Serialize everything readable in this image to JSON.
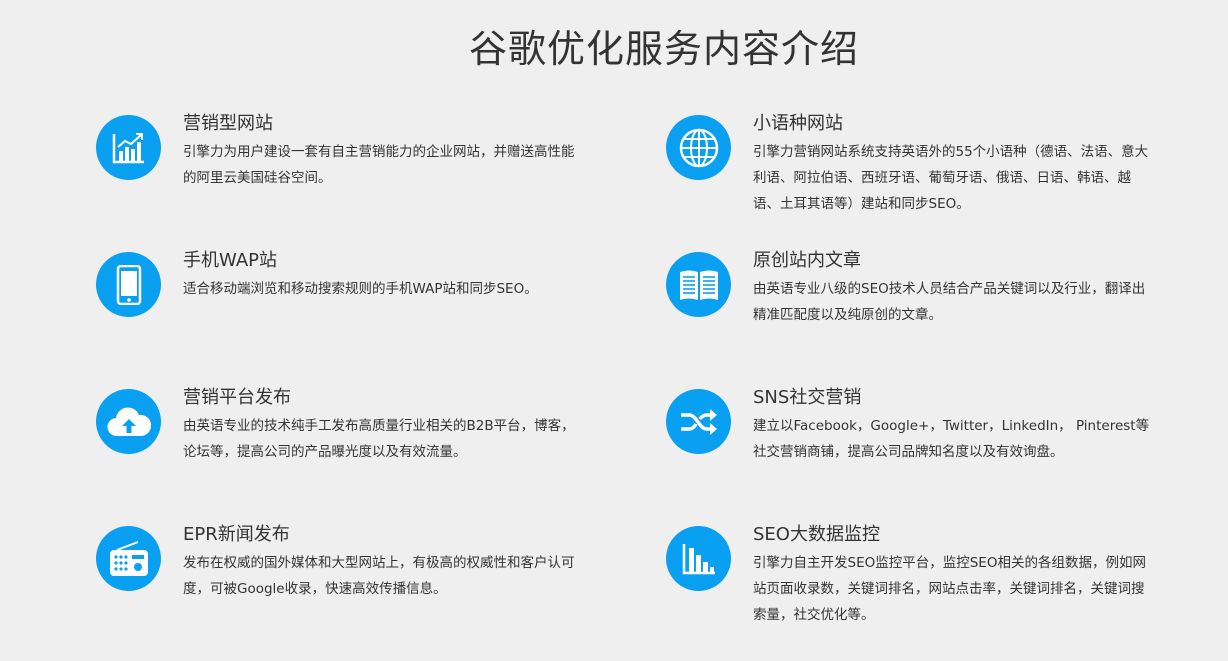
{
  "title": "谷歌优化服务内容介绍",
  "accent_color": "#0aa0f2",
  "items": [
    {
      "icon": "chart-up-icon",
      "heading": "营销型网站",
      "desc": "引擎力为用户建设一套有自主营销能力的企业网站，并赠送高性能的阿里云美国硅谷空间。"
    },
    {
      "icon": "globe-icon",
      "heading": "小语种网站",
      "desc": "引擎力营销网站系统支持英语外的55个小语种（德语、法语、意大利语、阿拉伯语、西班牙语、葡萄牙语、俄语、日语、韩语、越语、土耳其语等）建站和同步SEO。"
    },
    {
      "icon": "phone-icon",
      "heading": "手机WAP站",
      "desc": "适合移动端浏览和移动搜索规则的手机WAP站和同步SEO。"
    },
    {
      "icon": "book-icon",
      "heading": "原创站内文章",
      "desc": "由英语专业八级的SEO技术人员结合产品关键词以及行业，翻译出精准匹配度以及纯原创的文章。"
    },
    {
      "icon": "cloud-upload-icon",
      "heading": "营销平台发布",
      "desc": "由英语专业的技术纯手工发布高质量行业相关的B2B平台，博客，论坛等，提高公司的产品曝光度以及有效流量。"
    },
    {
      "icon": "shuffle-icon",
      "heading": "SNS社交营销",
      "desc": "建立以Facebook，Google+，Twitter，LinkedIn， Pinterest等社交营销商铺，提高公司品牌知名度以及有效询盘。"
    },
    {
      "icon": "radio-icon",
      "heading": "EPR新闻发布",
      "desc": "发布在权威的国外媒体和大型网站上，有极高的权威性和客户认可度，可被Google收录，快速高效传播信息。"
    },
    {
      "icon": "bar-chart-icon",
      "heading": "SEO大数据监控",
      "desc": "引擎力自主开发SEO监控平台，监控SEO相关的各组数据，例如网站页面收录数，关键词排名，网站点击率，关键词排名，关键词搜索量，社交优化等。"
    }
  ]
}
